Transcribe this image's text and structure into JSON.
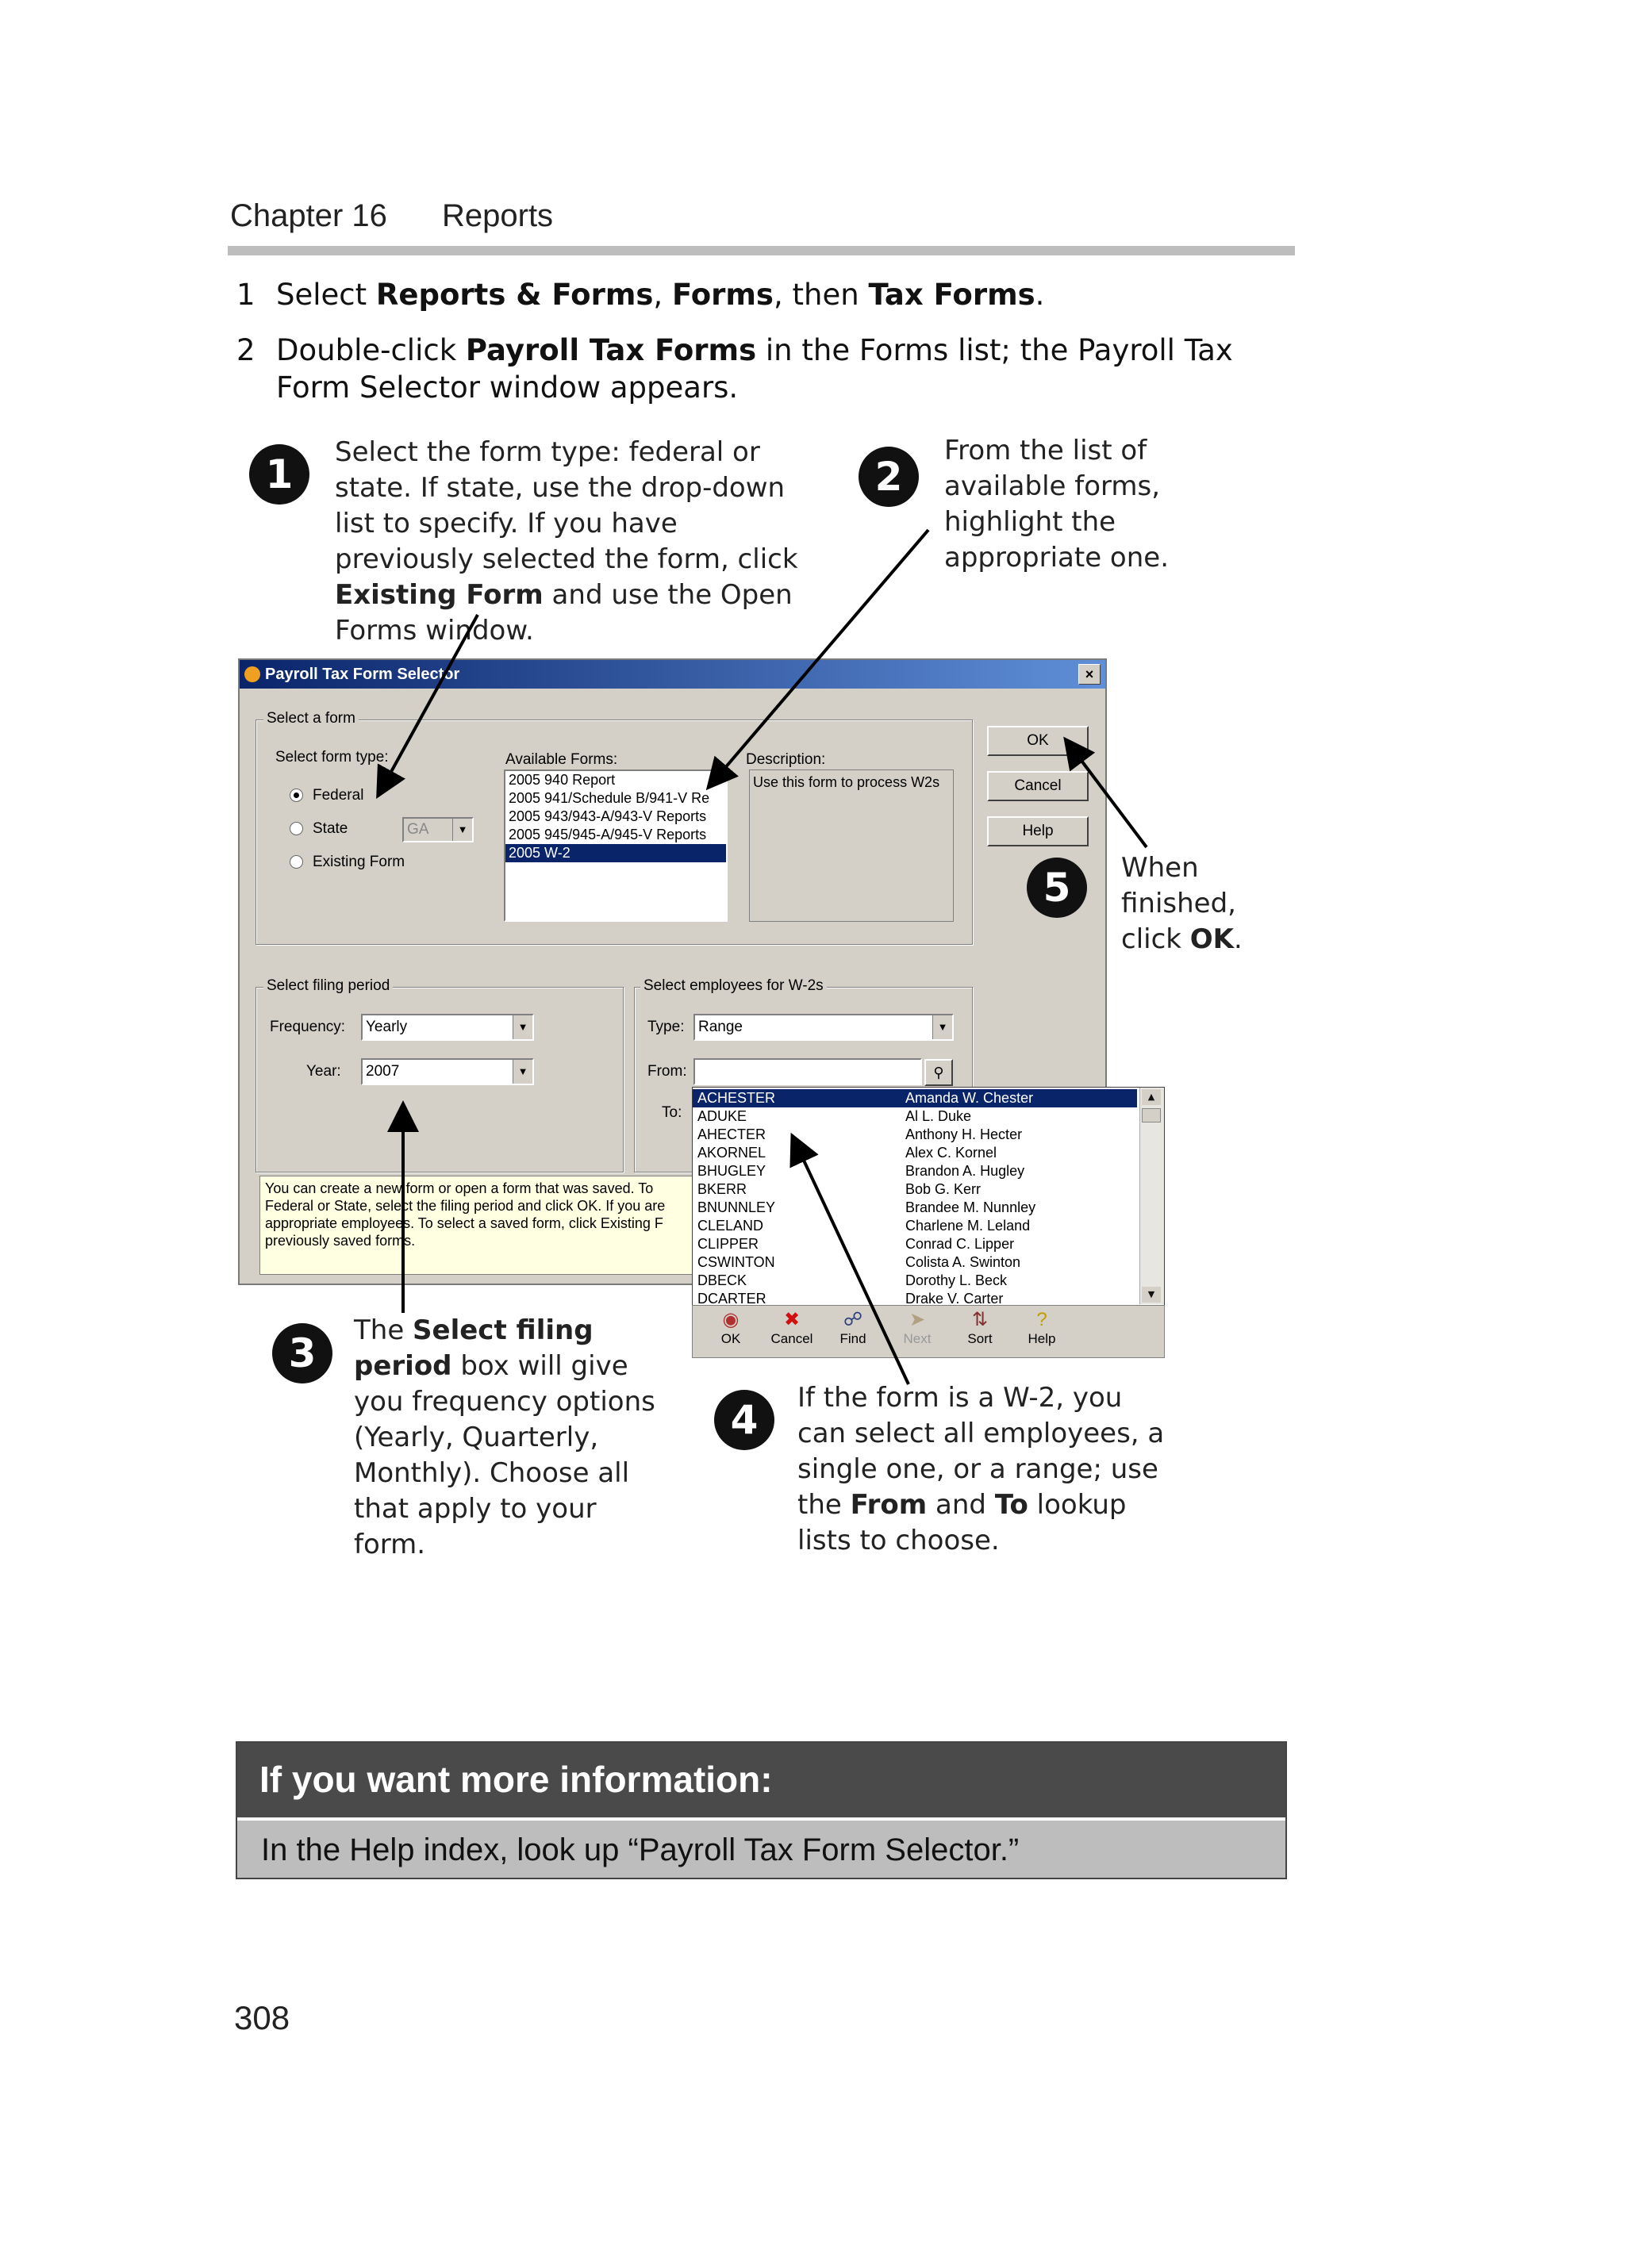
{
  "header": {
    "chapter": "Chapter 16",
    "section": "Reports"
  },
  "steps": [
    {
      "num": "1",
      "parts": [
        "Select ",
        "Reports & Forms",
        ", ",
        "Forms",
        ", then ",
        "Tax Forms",
        "."
      ]
    },
    {
      "num": "2",
      "parts": [
        "Double-click ",
        "Payroll Tax Forms",
        " in the Forms list; the Payroll Tax Form Selector window appears."
      ]
    }
  ],
  "callouts": {
    "c1": {
      "badge": "1",
      "a": "Select the form type: federal or state. If state, use the drop-down list to specify. If you have previously selected the form, click ",
      "b": "Existing Form",
      "c": " and use the Open Forms window."
    },
    "c2": {
      "badge": "2",
      "text": "From the list of available forms, highlight the appropriate one."
    },
    "c3": {
      "badge": "3",
      "a": "The ",
      "b": "Select filing period",
      "c": " box will give you frequency options (Yearly, Quarterly, Monthly). Choose all that apply to your form."
    },
    "c4": {
      "badge": "4",
      "a": "If the form is a W-2, you can select all employees, a single one, or a range; use the ",
      "b": "From",
      "c": " and ",
      "d": "To",
      "e": " lookup lists to choose."
    },
    "c5": {
      "badge": "5",
      "a": "When finished, click ",
      "b": "OK",
      "c": "."
    }
  },
  "dialog": {
    "title": "Payroll Tax Form Selector",
    "close": "×",
    "select_form": {
      "group": "Select a form",
      "type_label": "Select form type:",
      "federal": "Federal",
      "state": "State",
      "state_value": "GA",
      "existing": "Existing Form",
      "available_label": "Available Forms:",
      "available": [
        "2005 940 Report",
        "2005 941/Schedule B/941-V Re",
        "2005 943/943-A/943-V Reports",
        "2005 945/945-A/945-V Reports",
        "2005 W-2"
      ],
      "description_label": "Description:",
      "description": "Use this form to process W2s"
    },
    "buttons": {
      "ok": "OK",
      "cancel": "Cancel",
      "help": "Help"
    },
    "filing": {
      "group": "Select filing period",
      "freq_label": "Frequency:",
      "freq_value": "Yearly",
      "year_label": "Year:",
      "year_value": "2007"
    },
    "employees": {
      "group": "Select employees for W-2s",
      "type_label": "Type:",
      "type_value": "Range",
      "from_label": "From:",
      "to_label": "To:"
    },
    "note": "You can create a new form or open a form that was saved. To Federal or State, select the filing period and click OK. If you are appropriate employees. To select a saved form, click Existing F previously saved forms."
  },
  "lookup": {
    "rows": [
      [
        "ACHESTER",
        "Amanda W. Chester"
      ],
      [
        "ADUKE",
        "Al L. Duke"
      ],
      [
        "AHECTER",
        "Anthony H. Hecter"
      ],
      [
        "AKORNEL",
        "Alex C. Kornel"
      ],
      [
        "BHUGLEY",
        "Brandon A. Hugley"
      ],
      [
        "BKERR",
        "Bob G. Kerr"
      ],
      [
        "BNUNNLEY",
        "Brandee M. Nunnley"
      ],
      [
        "CLELAND",
        "Charlene M. Leland"
      ],
      [
        "CLIPPER",
        "Conrad C. Lipper"
      ],
      [
        "CSWINTON",
        "Colista A. Swinton"
      ],
      [
        "DBECK",
        "Dorothy L. Beck"
      ],
      [
        "DCARTER",
        "Drake V. Carter"
      ]
    ],
    "toolbar": [
      "OK",
      "Cancel",
      "Find",
      "Next",
      "Sort",
      "Help"
    ]
  },
  "info": {
    "title": "If you want more information:",
    "body": "In the Help index, look up “Payroll Tax Form Selector.”"
  },
  "page_number": "308"
}
